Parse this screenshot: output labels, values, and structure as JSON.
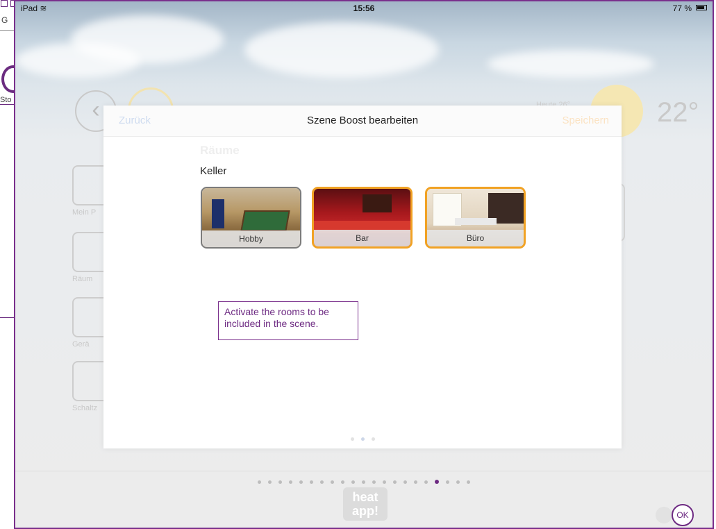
{
  "behind_window": {
    "fragment_letter": "G",
    "fragment_label": "Sto"
  },
  "status_bar": {
    "device": "iPad",
    "wifi_icon": "wifi-icon",
    "time": "15:56",
    "battery": "77 %"
  },
  "background_app": {
    "temperature": "22°",
    "small_text": "Heute 26°",
    "sidebar": [
      {
        "label": "Mein P"
      },
      {
        "label": "Räum"
      },
      {
        "label": "Gerä"
      },
      {
        "label": "Schaltz"
      }
    ],
    "logo_text": "heat app!",
    "ok_label": "OK",
    "page_dots_total": 21,
    "page_dots_active": 17
  },
  "modal": {
    "back_label": "Zurück",
    "title": "Szene Boost bearbeiten",
    "save_label": "Speichern",
    "section_title": "Räume",
    "floor_label": "Keller",
    "rooms": [
      {
        "name": "Hobby",
        "selected": false
      },
      {
        "name": "Bar",
        "selected": true
      },
      {
        "name": "Büro",
        "selected": true
      }
    ],
    "pager_total": 3,
    "pager_active": 1
  },
  "tooltip": {
    "text": "Activate the rooms to be included in the scene."
  },
  "colors": {
    "accent": "#7a2f8c",
    "selected_border": "#f1a224",
    "unselected_border": "#7b7b7b"
  }
}
